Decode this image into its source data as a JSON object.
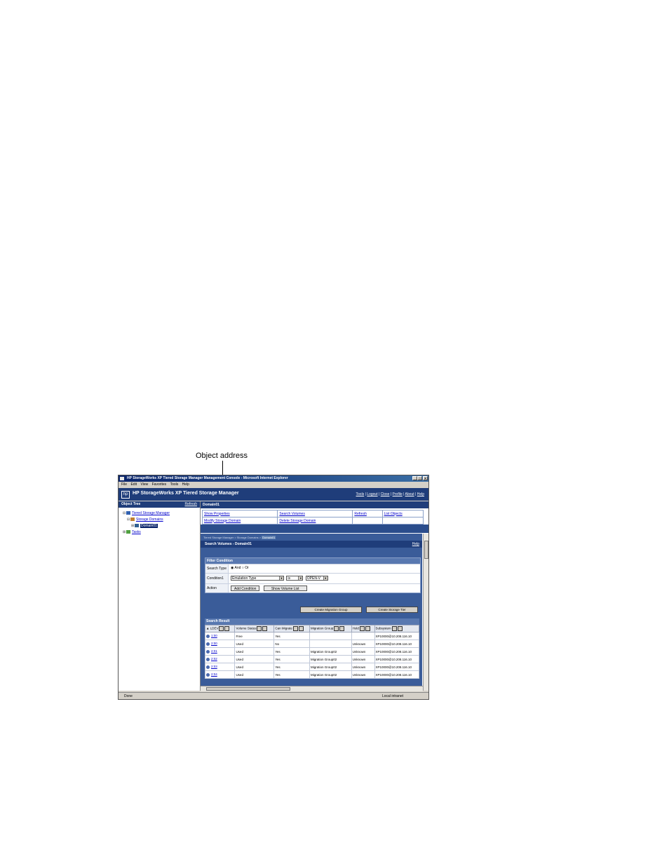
{
  "callout": {
    "label": "Object address"
  },
  "window": {
    "title": "HP StorageWorks XP Tiered Storage Manager Management Console - Microsoft Internet Explorer",
    "controls": {
      "minimize": "_",
      "maximize": "□",
      "close": "×"
    }
  },
  "menu": [
    "File",
    "Edit",
    "View",
    "Favorites",
    "Tools",
    "Help"
  ],
  "app": {
    "logo": "hp",
    "title": "HP StorageWorks XP Tiered Storage Manager",
    "links": [
      "Tools",
      "Logout",
      "Close",
      "Profile",
      "About",
      "Help"
    ]
  },
  "object_tree": {
    "header": "Object Tree",
    "refresh": "Refresh",
    "items": [
      {
        "label": "Tiered Storage Manager",
        "toggle": "⊟"
      },
      {
        "label": "Storage Domains",
        "toggle": "⊟"
      },
      {
        "label": "Domain01",
        "toggle": "⊞"
      },
      {
        "label": "Tasks",
        "toggle": "⊞"
      }
    ]
  },
  "domain": {
    "header": "Domain01",
    "actions": [
      [
        "Show Properties",
        "Search Volumes",
        "Refresh",
        "List Objects"
      ],
      [
        "Modify Storage Domain",
        "Delete Storage Domain",
        "",
        ""
      ]
    ]
  },
  "breadcrumb": {
    "path": "Tiered Storage Manager > Storage Domains > ",
    "current": "Domain01"
  },
  "search_volumes": {
    "title": "Search Volumes - Domain01",
    "help": "Help",
    "filter": {
      "header": "Filter Condition",
      "search_type_label": "Search Type",
      "search_type_and": "And",
      "search_type_or": "Or",
      "condition_label": "Condition1",
      "condition_field": "Emulation Type",
      "condition_op": "is",
      "condition_value": "OPEN-V",
      "action_label": "Action",
      "add_condition": "Add Condition",
      "show_volume_list": "Show Volume List"
    },
    "create_migration_group": "Create Migration Group",
    "create_storage_tier": "Create Storage Tier"
  },
  "search_result": {
    "header": "Search Result",
    "columns": [
      "▲ LDEV",
      "Volume Status",
      "Can Migrate",
      "Migration Group",
      "Hold",
      "Subsystem"
    ],
    "rows": [
      [
        "1:00",
        "Free",
        "Yes",
        "",
        "",
        "XP10000@10.208.116.10"
      ],
      [
        "2:00",
        "Used",
        "No",
        "",
        "Unknown",
        "XP10000@10.208.116.10"
      ],
      [
        "2:01",
        "Used",
        "Yes",
        "Migration Group02",
        "Unknown",
        "XP10000@10.208.116.10"
      ],
      [
        "2:02",
        "Used",
        "Yes",
        "Migration Group02",
        "Unknown",
        "XP10000@10.208.116.10"
      ],
      [
        "2:03",
        "Used",
        "Yes",
        "Migration Group02",
        "Unknown",
        "XP10000@10.208.116.10"
      ],
      [
        "2:04",
        "Used",
        "Yes",
        "Migration Group02",
        "Unknown",
        "XP10000@10.208.116.10"
      ]
    ]
  },
  "status": {
    "text": "Done",
    "zone": "Local intranet"
  }
}
